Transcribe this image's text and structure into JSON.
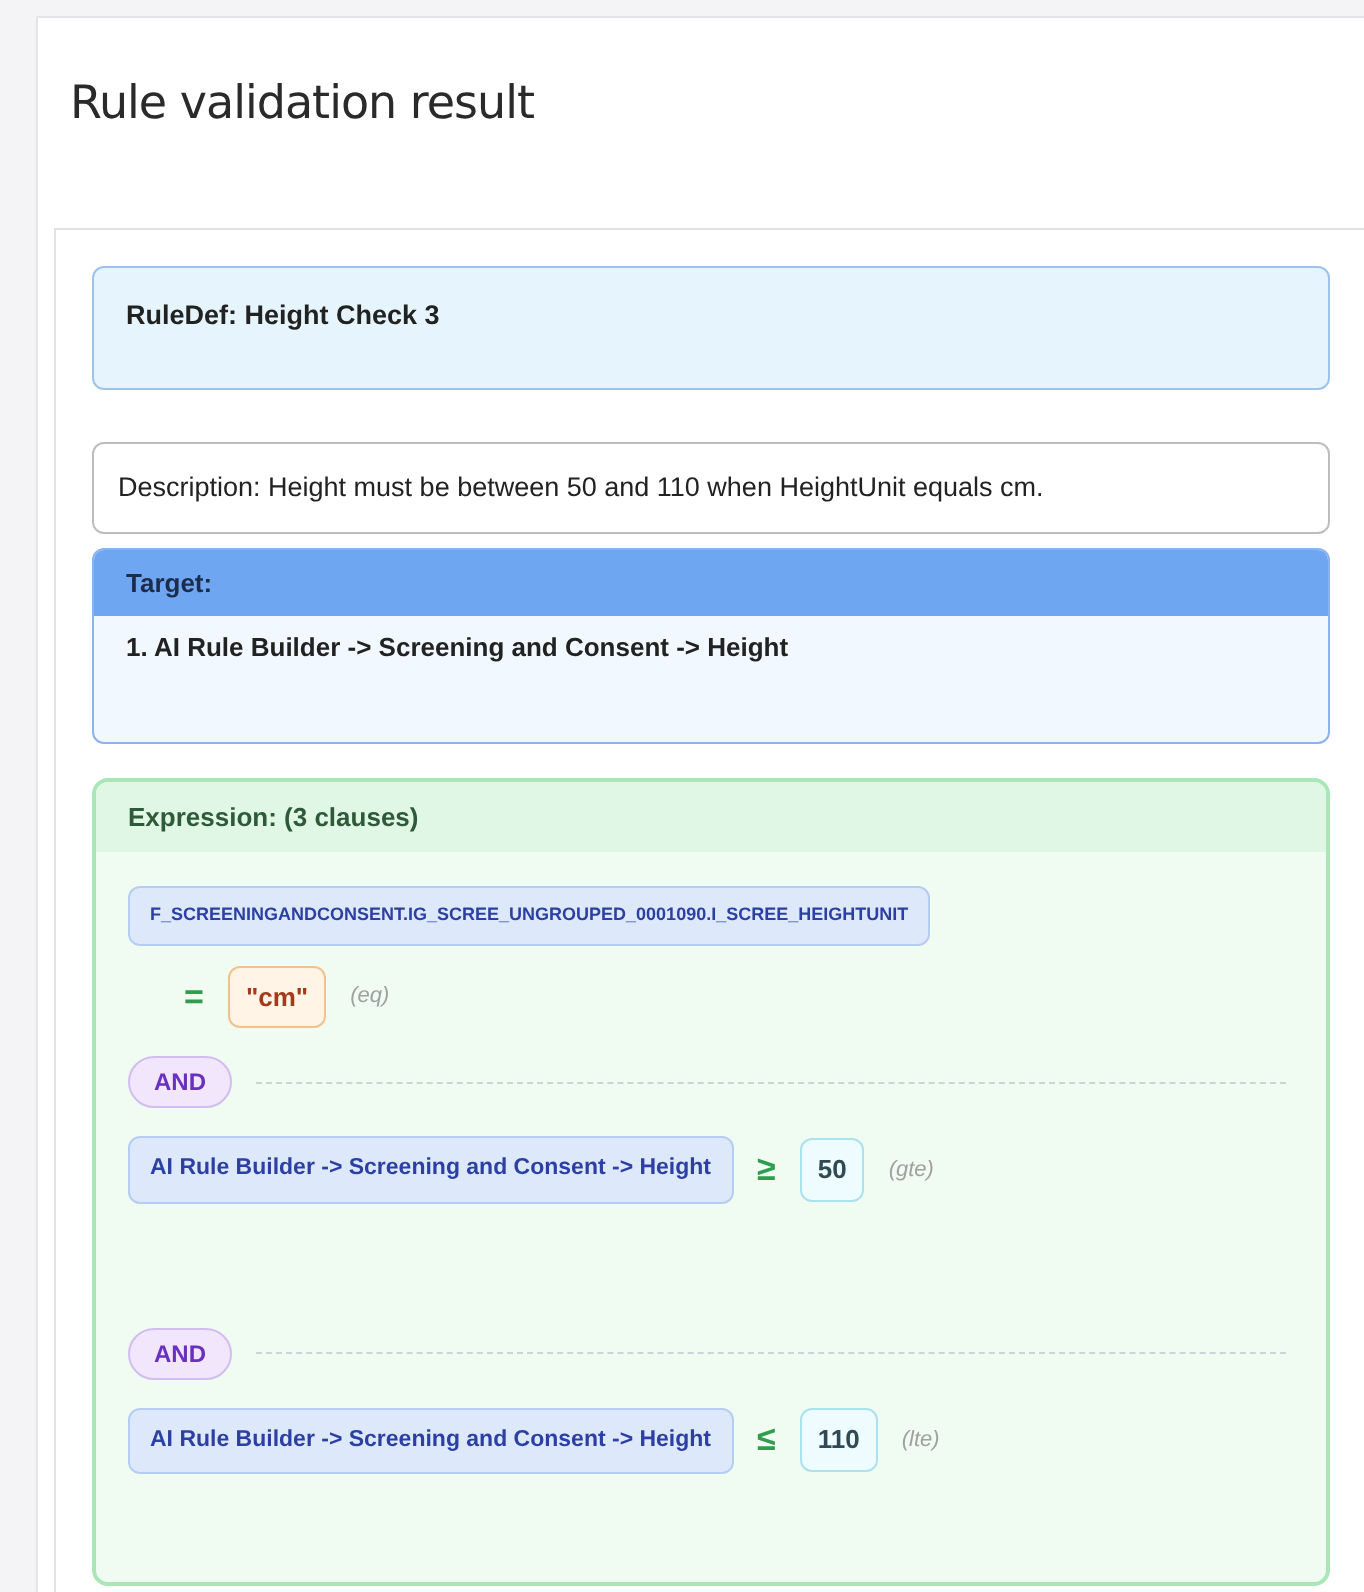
{
  "title": "Rule validation result",
  "rule_def": {
    "label": "RuleDef: Height Check 3"
  },
  "description": "Description: Height must be between 50 and 110 when HeightUnit equals cm.",
  "target": {
    "header": "Target:",
    "items": [
      "1. AI Rule Builder -> Screening and Consent -> Height"
    ]
  },
  "expression": {
    "header": "Expression: (3 clauses)",
    "clauses": [
      {
        "kind": "stacked",
        "field": "F_SCREENINGANDCONSENT.IG_SCREE_UNGROUPED_0001090.I_SCREE_HEIGHTUNIT",
        "operator": "=",
        "value": {
          "kind": "string",
          "text": "\"cm\""
        },
        "op_name": "(eq)"
      },
      {
        "kind": "connector",
        "label": "AND"
      },
      {
        "kind": "inline",
        "field": "AI Rule Builder -> Screening and Consent -> Height",
        "operator": "≥",
        "value": {
          "kind": "number",
          "text": "50"
        },
        "op_name": "(gte)"
      },
      {
        "kind": "connector",
        "label": "AND"
      },
      {
        "kind": "inline",
        "field": "AI Rule Builder -> Screening and Consent -> Height",
        "operator": "≤",
        "value": {
          "kind": "number",
          "text": "110"
        },
        "op_name": "(lte)"
      }
    ]
  }
}
